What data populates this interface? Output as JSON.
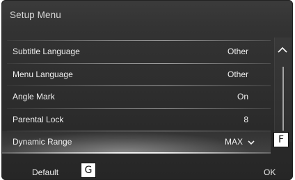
{
  "window": {
    "title": "Setup Menu"
  },
  "menu": {
    "items": [
      {
        "label": "Subtitle Language",
        "value": "Other"
      },
      {
        "label": "Menu Language",
        "value": "Other"
      },
      {
        "label": "Angle Mark",
        "value": "On"
      },
      {
        "label": "Parental Lock",
        "value": "8"
      },
      {
        "label": "Dynamic Range",
        "value": "MAX",
        "selected": true
      }
    ]
  },
  "footer": {
    "default_label": "Default",
    "ok_label": "OK"
  },
  "callouts": {
    "f": "F",
    "g": "G"
  },
  "icons": {
    "scroll_up": "chevron-up-icon",
    "expand": "chevron-down-icon"
  }
}
